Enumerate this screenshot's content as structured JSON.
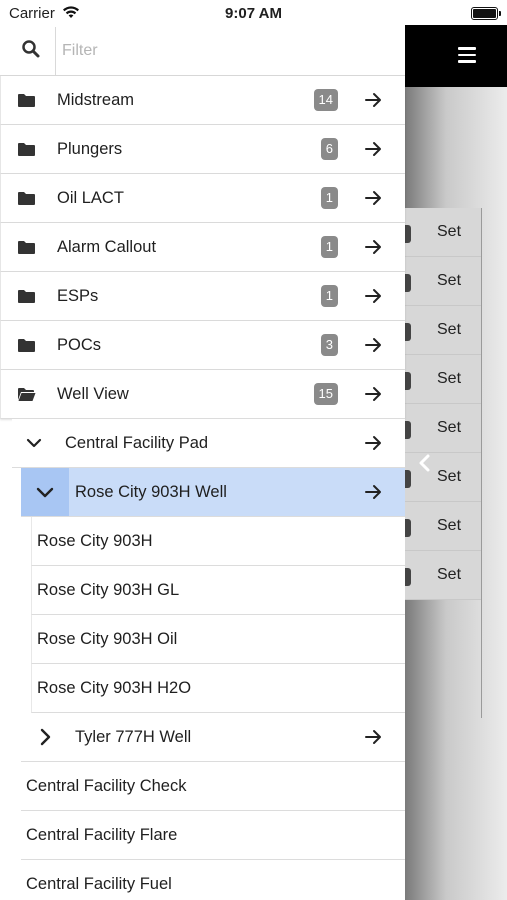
{
  "status_bar": {
    "carrier": "Carrier",
    "time": "9:07 AM"
  },
  "filter": {
    "placeholder": "Filter",
    "value": ""
  },
  "folders": [
    {
      "label": "Midstream",
      "count": "14"
    },
    {
      "label": "Plungers",
      "count": "6"
    },
    {
      "label": "Oil LACT",
      "count": "1"
    },
    {
      "label": "Alarm Callout",
      "count": "1"
    },
    {
      "label": "ESPs",
      "count": "1"
    },
    {
      "label": "POCs",
      "count": "3"
    },
    {
      "label": "Well View",
      "count": "15"
    }
  ],
  "tree": {
    "group": "Central Facility Pad",
    "expanded_well": "Rose City 903H Well",
    "expanded_children": [
      "Rose City 903H",
      "Rose City 903H GL",
      "Rose City 903H Oil",
      "Rose City 903H H2O"
    ],
    "collapsed_well": "Tyler 777H Well",
    "leaves": [
      "Central Facility Check",
      "Central Facility Flare",
      "Central Facility Fuel"
    ]
  },
  "background": {
    "set_label": "Set",
    "set_rows": [
      "Set",
      "Set",
      "Set",
      "Set",
      "Set",
      "Set",
      "Set",
      "Set"
    ]
  },
  "colors": {
    "selected_row": "#c9dcf8",
    "selected_chevron_box": "#a8c6f3",
    "badge": "#8a8a8a",
    "header": "#000000"
  }
}
